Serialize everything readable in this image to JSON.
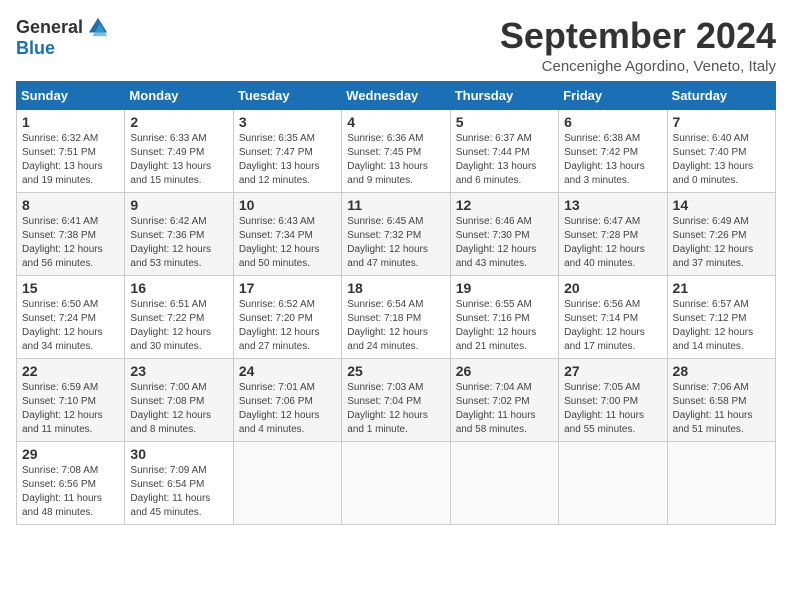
{
  "header": {
    "logo_general": "General",
    "logo_blue": "Blue",
    "month_title": "September 2024",
    "location": "Cencenighe Agordino, Veneto, Italy"
  },
  "calendar": {
    "days_of_week": [
      "Sunday",
      "Monday",
      "Tuesday",
      "Wednesday",
      "Thursday",
      "Friday",
      "Saturday"
    ],
    "weeks": [
      [
        {
          "day": "",
          "info": ""
        },
        {
          "day": "2",
          "info": "Sunrise: 6:33 AM\nSunset: 7:49 PM\nDaylight: 13 hours\nand 15 minutes."
        },
        {
          "day": "3",
          "info": "Sunrise: 6:35 AM\nSunset: 7:47 PM\nDaylight: 13 hours\nand 12 minutes."
        },
        {
          "day": "4",
          "info": "Sunrise: 6:36 AM\nSunset: 7:45 PM\nDaylight: 13 hours\nand 9 minutes."
        },
        {
          "day": "5",
          "info": "Sunrise: 6:37 AM\nSunset: 7:44 PM\nDaylight: 13 hours\nand 6 minutes."
        },
        {
          "day": "6",
          "info": "Sunrise: 6:38 AM\nSunset: 7:42 PM\nDaylight: 13 hours\nand 3 minutes."
        },
        {
          "day": "7",
          "info": "Sunrise: 6:40 AM\nSunset: 7:40 PM\nDaylight: 13 hours\nand 0 minutes."
        }
      ],
      [
        {
          "day": "1",
          "info": "Sunrise: 6:32 AM\nSunset: 7:51 PM\nDaylight: 13 hours\nand 19 minutes."
        },
        {
          "day": "9",
          "info": "Sunrise: 6:42 AM\nSunset: 7:36 PM\nDaylight: 12 hours\nand 53 minutes."
        },
        {
          "day": "10",
          "info": "Sunrise: 6:43 AM\nSunset: 7:34 PM\nDaylight: 12 hours\nand 50 minutes."
        },
        {
          "day": "11",
          "info": "Sunrise: 6:45 AM\nSunset: 7:32 PM\nDaylight: 12 hours\nand 47 minutes."
        },
        {
          "day": "12",
          "info": "Sunrise: 6:46 AM\nSunset: 7:30 PM\nDaylight: 12 hours\nand 43 minutes."
        },
        {
          "day": "13",
          "info": "Sunrise: 6:47 AM\nSunset: 7:28 PM\nDaylight: 12 hours\nand 40 minutes."
        },
        {
          "day": "14",
          "info": "Sunrise: 6:49 AM\nSunset: 7:26 PM\nDaylight: 12 hours\nand 37 minutes."
        }
      ],
      [
        {
          "day": "8",
          "info": "Sunrise: 6:41 AM\nSunset: 7:38 PM\nDaylight: 12 hours\nand 56 minutes."
        },
        {
          "day": "16",
          "info": "Sunrise: 6:51 AM\nSunset: 7:22 PM\nDaylight: 12 hours\nand 30 minutes."
        },
        {
          "day": "17",
          "info": "Sunrise: 6:52 AM\nSunset: 7:20 PM\nDaylight: 12 hours\nand 27 minutes."
        },
        {
          "day": "18",
          "info": "Sunrise: 6:54 AM\nSunset: 7:18 PM\nDaylight: 12 hours\nand 24 minutes."
        },
        {
          "day": "19",
          "info": "Sunrise: 6:55 AM\nSunset: 7:16 PM\nDaylight: 12 hours\nand 21 minutes."
        },
        {
          "day": "20",
          "info": "Sunrise: 6:56 AM\nSunset: 7:14 PM\nDaylight: 12 hours\nand 17 minutes."
        },
        {
          "day": "21",
          "info": "Sunrise: 6:57 AM\nSunset: 7:12 PM\nDaylight: 12 hours\nand 14 minutes."
        }
      ],
      [
        {
          "day": "15",
          "info": "Sunrise: 6:50 AM\nSunset: 7:24 PM\nDaylight: 12 hours\nand 34 minutes."
        },
        {
          "day": "23",
          "info": "Sunrise: 7:00 AM\nSunset: 7:08 PM\nDaylight: 12 hours\nand 8 minutes."
        },
        {
          "day": "24",
          "info": "Sunrise: 7:01 AM\nSunset: 7:06 PM\nDaylight: 12 hours\nand 4 minutes."
        },
        {
          "day": "25",
          "info": "Sunrise: 7:03 AM\nSunset: 7:04 PM\nDaylight: 12 hours\nand 1 minute."
        },
        {
          "day": "26",
          "info": "Sunrise: 7:04 AM\nSunset: 7:02 PM\nDaylight: 11 hours\nand 58 minutes."
        },
        {
          "day": "27",
          "info": "Sunrise: 7:05 AM\nSunset: 7:00 PM\nDaylight: 11 hours\nand 55 minutes."
        },
        {
          "day": "28",
          "info": "Sunrise: 7:06 AM\nSunset: 6:58 PM\nDaylight: 11 hours\nand 51 minutes."
        }
      ],
      [
        {
          "day": "22",
          "info": "Sunrise: 6:59 AM\nSunset: 7:10 PM\nDaylight: 12 hours\nand 11 minutes."
        },
        {
          "day": "30",
          "info": "Sunrise: 7:09 AM\nSunset: 6:54 PM\nDaylight: 11 hours\nand 45 minutes."
        },
        {
          "day": "",
          "info": ""
        },
        {
          "day": "",
          "info": ""
        },
        {
          "day": "",
          "info": ""
        },
        {
          "day": "",
          "info": ""
        },
        {
          "day": "",
          "info": ""
        }
      ],
      [
        {
          "day": "29",
          "info": "Sunrise: 7:08 AM\nSunset: 6:56 PM\nDaylight: 11 hours\nand 48 minutes."
        },
        {
          "day": "",
          "info": ""
        },
        {
          "day": "",
          "info": ""
        },
        {
          "day": "",
          "info": ""
        },
        {
          "day": "",
          "info": ""
        },
        {
          "day": "",
          "info": ""
        },
        {
          "day": "",
          "info": ""
        }
      ]
    ]
  }
}
